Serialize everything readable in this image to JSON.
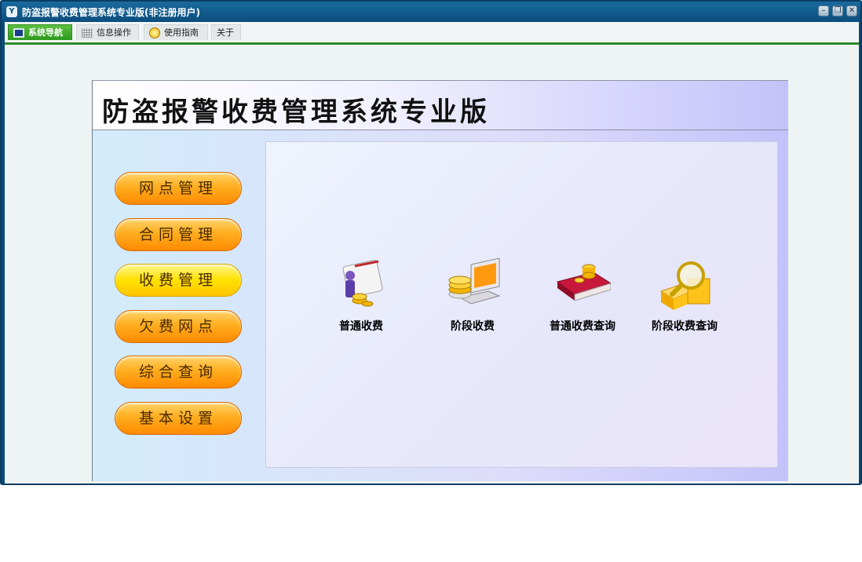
{
  "window": {
    "title": "防盗报警收费管理系统专业版(非注册用户)"
  },
  "window_controls": {
    "minimize": "–",
    "restore": "❐",
    "close": "✕"
  },
  "menu": {
    "tabs": [
      {
        "label": "系统导航",
        "icon": "monitor-icon"
      },
      {
        "label": "信息操作",
        "icon": "grid-icon"
      },
      {
        "label": "使用指南",
        "icon": "bulb-icon"
      },
      {
        "label": "关于",
        "icon": ""
      }
    ]
  },
  "panel": {
    "title": "防盗报警收费管理系统专业版"
  },
  "sidebar": {
    "buttons": [
      {
        "label": "网点管理"
      },
      {
        "label": "合同管理"
      },
      {
        "label": "收费管理"
      },
      {
        "label": "欠费网点"
      },
      {
        "label": "综合查询"
      },
      {
        "label": "基本设置"
      }
    ]
  },
  "launchers": [
    {
      "label": "普通收费",
      "icon": "person-document-coins-icon"
    },
    {
      "label": "阶段收费",
      "icon": "laptop-coins-icon"
    },
    {
      "label": "普通收费查询",
      "icon": "book-coins-icon"
    },
    {
      "label": "阶段收费查询",
      "icon": "magnifier-boxes-icon"
    }
  ],
  "colors": {
    "accent_green": "#2b8a2b",
    "button_orange": "#ff9a10",
    "button_yellow": "#ffe100",
    "titlebar": "#0b4d7d"
  }
}
